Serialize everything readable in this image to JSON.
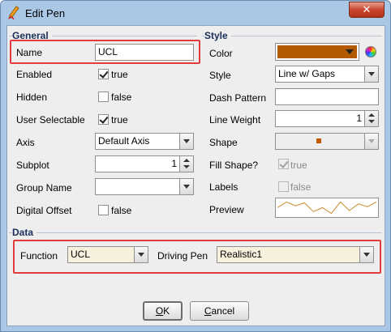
{
  "window": {
    "title": "Edit Pen",
    "close_glyph": "✕",
    "icon": "pencil-icon"
  },
  "general": {
    "title": "General",
    "name_label": "Name",
    "name_value": "UCL",
    "enabled_label": "Enabled",
    "enabled_checked": true,
    "enabled_text": "true",
    "hidden_label": "Hidden",
    "hidden_checked": false,
    "hidden_text": "false",
    "user_selectable_label": "User Selectable",
    "user_selectable_checked": true,
    "user_selectable_text": "true",
    "axis_label": "Axis",
    "axis_value": "Default Axis",
    "subplot_label": "Subplot",
    "subplot_value": "1",
    "group_name_label": "Group Name",
    "group_name_value": "",
    "digital_offset_label": "Digital Offset",
    "digital_offset_checked": false,
    "digital_offset_text": "false"
  },
  "style": {
    "title": "Style",
    "color_label": "Color",
    "color_value": "#b35900",
    "style_label": "Style",
    "style_value": "Line w/ Gaps",
    "dash_pattern_label": "Dash Pattern",
    "dash_pattern_value": "",
    "line_weight_label": "Line Weight",
    "line_weight_value": "1",
    "shape_label": "Shape",
    "shape_color": "#c45a00",
    "fill_shape_label": "Fill Shape?",
    "fill_shape_checked": true,
    "fill_shape_text": "true",
    "labels_label": "Labels",
    "labels_checked": false,
    "labels_text": "false",
    "preview_label": "Preview",
    "preview_line_color": "#c88a2a",
    "preview_points": [
      8,
      14,
      10,
      13,
      4,
      8,
      2,
      14,
      5,
      12,
      9,
      14
    ]
  },
  "data": {
    "title": "Data",
    "function_label": "Function",
    "function_value": "UCL",
    "driving_pen_label": "Driving Pen",
    "driving_pen_value": "Realistic1"
  },
  "buttons": {
    "ok_mnemonic": "O",
    "ok_rest": "K",
    "cancel_mnemonic": "C",
    "cancel_rest": "ancel"
  },
  "highlight_color": "#e23b3b"
}
